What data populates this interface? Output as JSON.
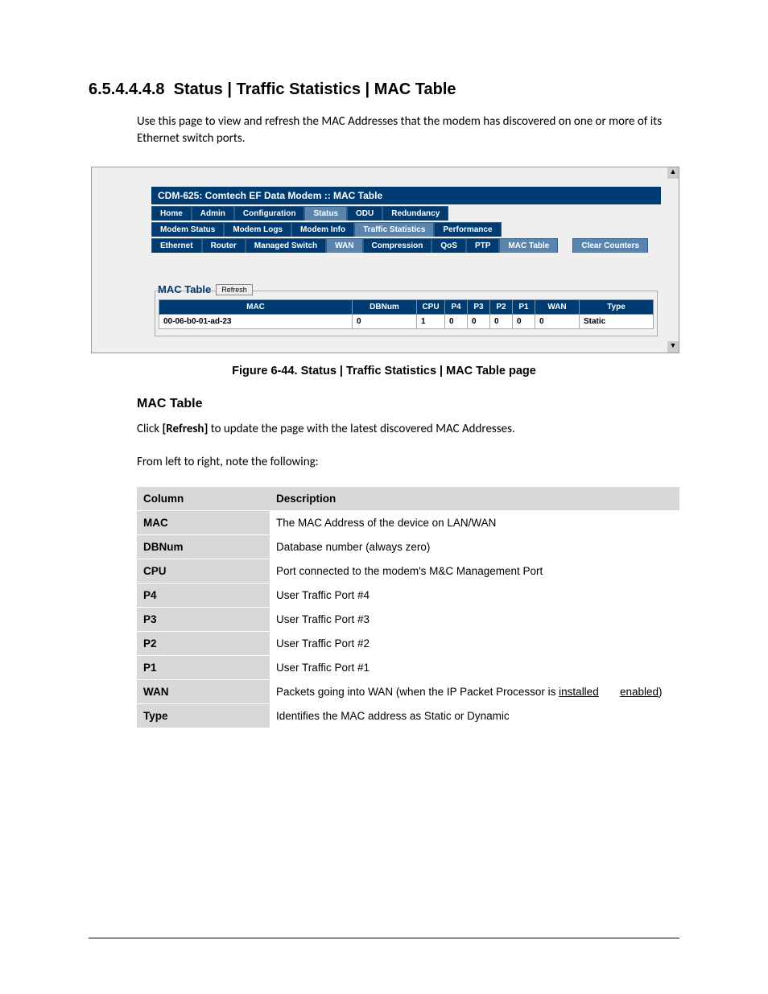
{
  "heading_number": "6.5.4.4.4.8",
  "heading_title": "Status | Traffic Statistics | MAC Table",
  "intro": "Use this page to view and refresh the MAC Addresses that the modem has discovered on one or more of its Ethernet switch ports.",
  "window_title": "CDM-625: Comtech EF Data Modem :: MAC Table",
  "tab_rows": {
    "row1": [
      "Home",
      "Admin",
      "Configuration",
      "Status",
      "ODU",
      "Redundancy"
    ],
    "row1_light_index": 3,
    "row2": [
      "Modem Status",
      "Modem Logs",
      "Modem Info",
      "Traffic Statistics",
      "Performance"
    ],
    "row2_light_index": 3,
    "row3": [
      "Ethernet",
      "Router",
      "Managed Switch",
      "WAN",
      "Compression",
      "QoS",
      "PTP",
      "MAC Table"
    ],
    "row3_light_indices": [
      3,
      7
    ],
    "row3_action": "Clear Counters"
  },
  "fieldset_label": "MAC Table",
  "refresh_label": "Refresh",
  "mac_table": {
    "headers": [
      "MAC",
      "DBNum",
      "CPU",
      "P4",
      "P3",
      "P2",
      "P1",
      "WAN",
      "Type"
    ],
    "rows": [
      {
        "c": [
          "00-06-b0-01-ad-23",
          "0",
          "1",
          "0",
          "0",
          "0",
          "0",
          "0",
          "Static"
        ]
      }
    ]
  },
  "figure_caption": "Figure 6-44. Status | Traffic Statistics | MAC Table page",
  "subheading": "MAC Table",
  "para_click_refresh_pre": "Click ",
  "para_click_refresh_bold": "[Refresh]",
  "para_click_refresh_post": " to update the page with the latest discovered MAC Addresses.",
  "para_fromleft": "From left to right, note the following:",
  "desc_table": {
    "headers": [
      "Column",
      "Description"
    ],
    "rows": [
      [
        "MAC",
        "The MAC Address of the device on LAN/WAN"
      ],
      [
        "DBNum",
        "Database number (always zero)"
      ],
      [
        "CPU",
        "Port connected to the modem's M&C Management Port"
      ],
      [
        "P4",
        "User Traffic Port #4"
      ],
      [
        "P3",
        "User Traffic Port #3"
      ],
      [
        "P2",
        "User Traffic Port #2"
      ],
      [
        "P1",
        "User Traffic Port #1"
      ],
      [
        "WAN",
        "__WAN_ROW__"
      ],
      [
        "Type",
        "Identifies the MAC address as Static or Dynamic"
      ]
    ],
    "wan_row_pre": "Packets going into WAN (when the IP Packet Processor is ",
    "wan_row_u1": "installed",
    "wan_row_sep": " ",
    "wan_row_u2": "enabled",
    "wan_row_post": ")"
  }
}
